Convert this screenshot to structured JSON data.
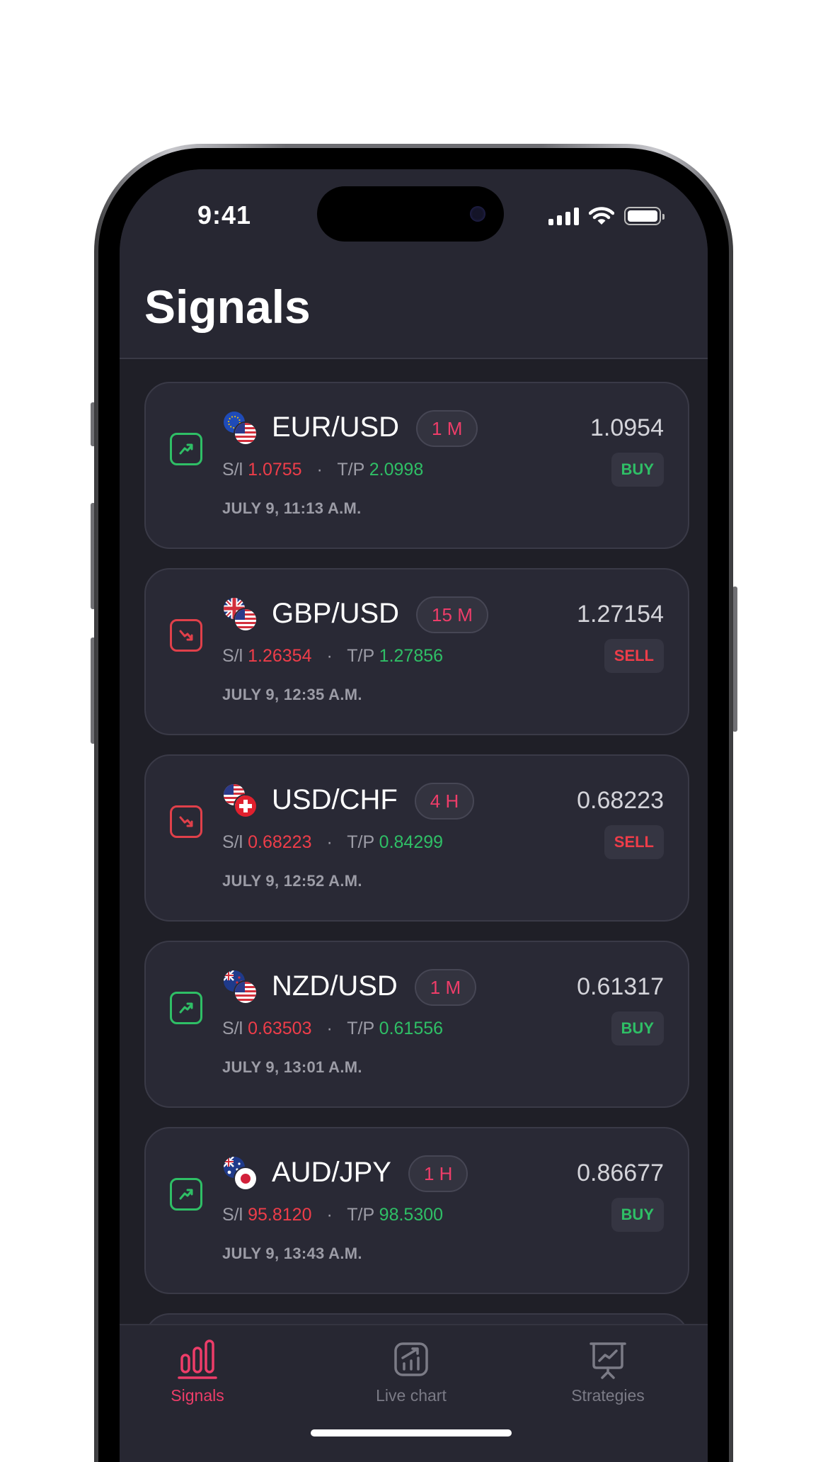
{
  "status_bar": {
    "time": "9:41"
  },
  "header": {
    "title": "Signals"
  },
  "signals": [
    {
      "pair": "EUR/USD",
      "base_flag": "eu-flag",
      "quote_flag": "us-flag",
      "timeframe": "1 M",
      "price": "1.0954",
      "action": "BUY",
      "trend": "up",
      "sl_label": "S/l",
      "sl": "1.0755",
      "tp_label": "T/P",
      "tp": "2.0998",
      "date": "JULY 9, 11:13 A.M."
    },
    {
      "pair": "GBP/USD",
      "base_flag": "gb-flag",
      "quote_flag": "us-flag",
      "timeframe": "15 M",
      "price": "1.27154",
      "action": "SELL",
      "trend": "down",
      "sl_label": "S/l",
      "sl": "1.26354",
      "tp_label": "T/P",
      "tp": "1.27856",
      "date": "JULY 9, 12:35 A.M."
    },
    {
      "pair": "USD/CHF",
      "base_flag": "us-flag",
      "quote_flag": "ch-flag",
      "timeframe": "4 H",
      "price": "0.68223",
      "action": "SELL",
      "trend": "down",
      "sl_label": "S/l",
      "sl": "0.68223",
      "tp_label": "T/P",
      "tp": "0.84299",
      "date": "JULY 9, 12:52 A.M."
    },
    {
      "pair": "NZD/USD",
      "base_flag": "nz-flag",
      "quote_flag": "us-flag",
      "timeframe": "1 M",
      "price": "0.61317",
      "action": "BUY",
      "trend": "up",
      "sl_label": "S/l",
      "sl": "0.63503",
      "tp_label": "T/P",
      "tp": "0.61556",
      "date": "JULY 9, 13:01 A.M."
    },
    {
      "pair": "AUD/JPY",
      "base_flag": "au-flag",
      "quote_flag": "jp-flag",
      "timeframe": "1 H",
      "price": "0.86677",
      "action": "BUY",
      "trend": "up",
      "sl_label": "S/l",
      "sl": "95.8120",
      "tp_label": "T/P",
      "tp": "98.5300",
      "date": "JULY 9, 13:43 A.M."
    }
  ],
  "tabs": [
    {
      "label": "Signals",
      "icon": "bar-chart-icon",
      "active": true
    },
    {
      "label": "Live chart",
      "icon": "chart-growth-icon",
      "active": false
    },
    {
      "label": "Strategies",
      "icon": "presentation-board-icon",
      "active": false
    }
  ],
  "colors": {
    "background": "#1f1f27",
    "card": "#292935",
    "accent": "#ee3d69",
    "buy": "#2fbf66",
    "sell": "#ee3d49"
  }
}
